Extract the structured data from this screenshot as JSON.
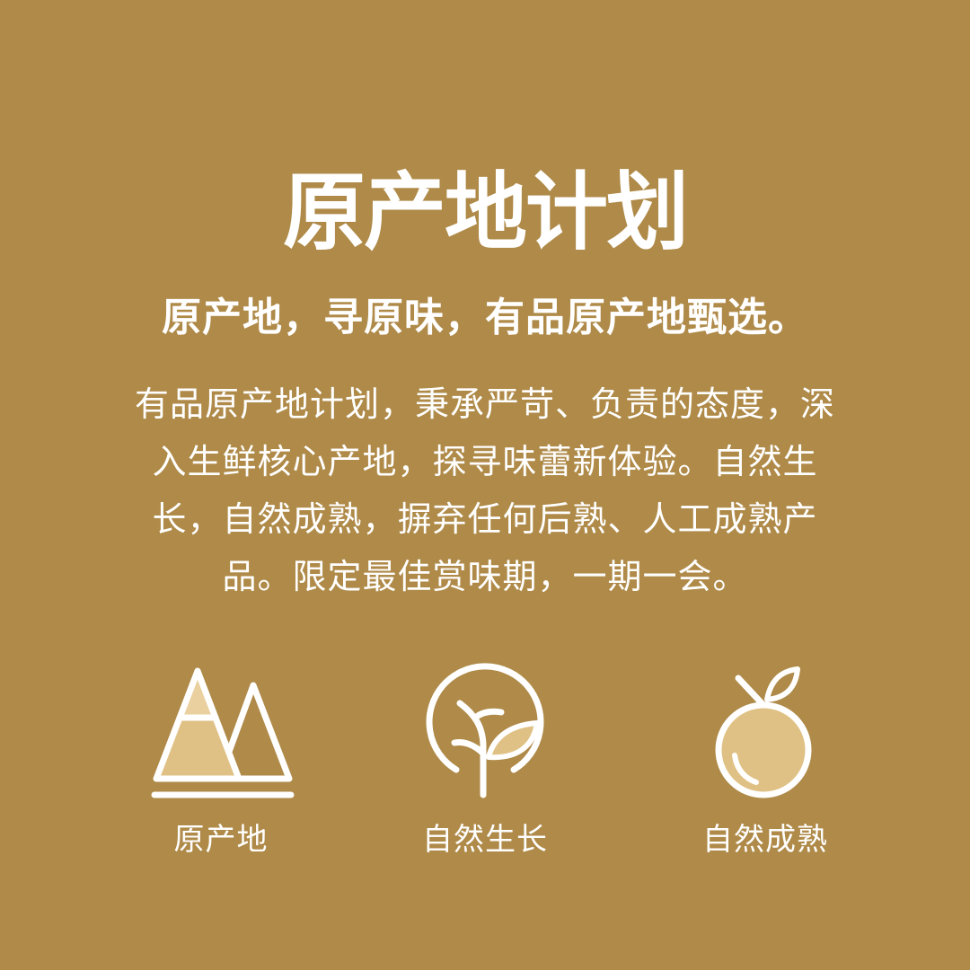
{
  "header": {
    "title": "原产地计划",
    "subtitle": "原产地，寻原味，有品原产地甄选。"
  },
  "description": {
    "lines": [
      "有品原产地计划，秉承严苛、负责的态度，深",
      "入生鲜核心产地，探寻味蕾新体验。自然生",
      "长，自然成熟，摒弃任何后熟、人工成熟产",
      "品。限定最佳赏味期，一期一会。"
    ]
  },
  "features": [
    {
      "icon": "mountain-icon",
      "label": "原产地"
    },
    {
      "icon": "tree-icon",
      "label": "自然生长"
    },
    {
      "icon": "fruit-icon",
      "label": "自然成熟"
    }
  ],
  "colors": {
    "background": "#af8a48",
    "icon_fill": "#e0c185",
    "text": "#ffffff"
  }
}
